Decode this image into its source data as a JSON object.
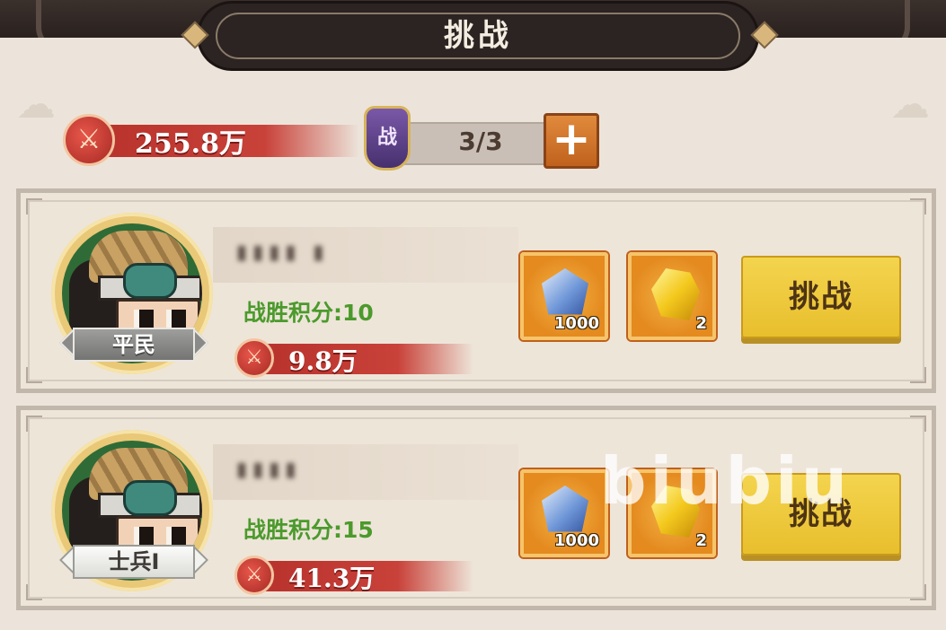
{
  "header": {
    "title": "挑战"
  },
  "stats": {
    "power": "255.8万",
    "tickets": "3/3",
    "ticket_icon_char": "战",
    "add_symbol": "+"
  },
  "opponents": [
    {
      "name": "▮▮▮▮ ▮",
      "win_score": "战胜积分:10",
      "power": "9.8万",
      "rank": "平民",
      "rewards": [
        {
          "icon": "crystal-icon",
          "qty": "1000"
        },
        {
          "icon": "gold-ore-icon",
          "qty": "2"
        }
      ],
      "button": "挑战"
    },
    {
      "name": "▮▮▮▮",
      "win_score": "战胜积分:15",
      "power": "41.3万",
      "rank": "士兵Ⅰ",
      "rewards": [
        {
          "icon": "crystal-icon",
          "qty": "1000"
        },
        {
          "icon": "gold-ore-icon",
          "qty": "2"
        }
      ],
      "button": "挑战"
    }
  ],
  "watermark": "biubiu",
  "colors": {
    "panel": "#ece4da",
    "power_red": "#c8423a",
    "win_green": "#4b9a2c",
    "button_yellow": "#f4d44e"
  }
}
